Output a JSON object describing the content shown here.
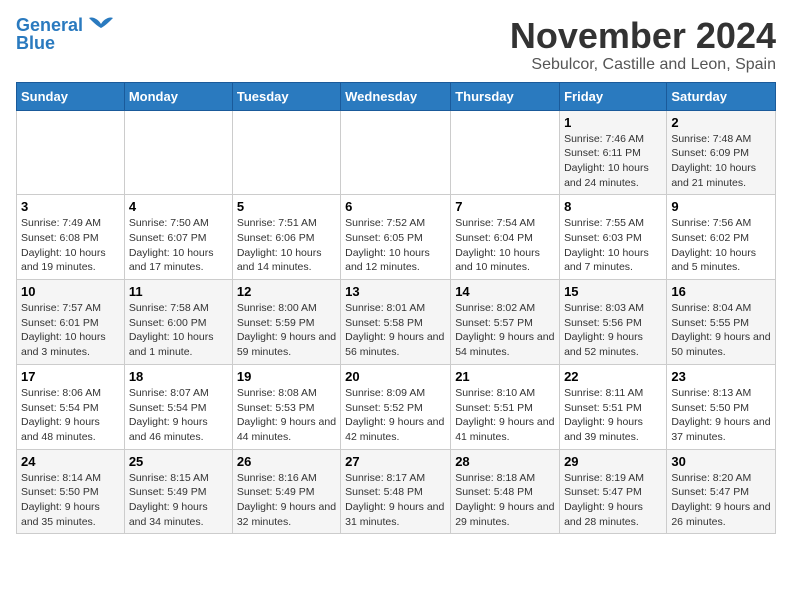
{
  "header": {
    "logo_line1": "General",
    "logo_line2": "Blue",
    "month": "November 2024",
    "location": "Sebulcor, Castille and Leon, Spain"
  },
  "weekdays": [
    "Sunday",
    "Monday",
    "Tuesday",
    "Wednesday",
    "Thursday",
    "Friday",
    "Saturday"
  ],
  "weeks": [
    [
      {
        "day": "",
        "info": ""
      },
      {
        "day": "",
        "info": ""
      },
      {
        "day": "",
        "info": ""
      },
      {
        "day": "",
        "info": ""
      },
      {
        "day": "",
        "info": ""
      },
      {
        "day": "1",
        "info": "Sunrise: 7:46 AM\nSunset: 6:11 PM\nDaylight: 10 hours and 24 minutes."
      },
      {
        "day": "2",
        "info": "Sunrise: 7:48 AM\nSunset: 6:09 PM\nDaylight: 10 hours and 21 minutes."
      }
    ],
    [
      {
        "day": "3",
        "info": "Sunrise: 7:49 AM\nSunset: 6:08 PM\nDaylight: 10 hours and 19 minutes."
      },
      {
        "day": "4",
        "info": "Sunrise: 7:50 AM\nSunset: 6:07 PM\nDaylight: 10 hours and 17 minutes."
      },
      {
        "day": "5",
        "info": "Sunrise: 7:51 AM\nSunset: 6:06 PM\nDaylight: 10 hours and 14 minutes."
      },
      {
        "day": "6",
        "info": "Sunrise: 7:52 AM\nSunset: 6:05 PM\nDaylight: 10 hours and 12 minutes."
      },
      {
        "day": "7",
        "info": "Sunrise: 7:54 AM\nSunset: 6:04 PM\nDaylight: 10 hours and 10 minutes."
      },
      {
        "day": "8",
        "info": "Sunrise: 7:55 AM\nSunset: 6:03 PM\nDaylight: 10 hours and 7 minutes."
      },
      {
        "day": "9",
        "info": "Sunrise: 7:56 AM\nSunset: 6:02 PM\nDaylight: 10 hours and 5 minutes."
      }
    ],
    [
      {
        "day": "10",
        "info": "Sunrise: 7:57 AM\nSunset: 6:01 PM\nDaylight: 10 hours and 3 minutes."
      },
      {
        "day": "11",
        "info": "Sunrise: 7:58 AM\nSunset: 6:00 PM\nDaylight: 10 hours and 1 minute."
      },
      {
        "day": "12",
        "info": "Sunrise: 8:00 AM\nSunset: 5:59 PM\nDaylight: 9 hours and 59 minutes."
      },
      {
        "day": "13",
        "info": "Sunrise: 8:01 AM\nSunset: 5:58 PM\nDaylight: 9 hours and 56 minutes."
      },
      {
        "day": "14",
        "info": "Sunrise: 8:02 AM\nSunset: 5:57 PM\nDaylight: 9 hours and 54 minutes."
      },
      {
        "day": "15",
        "info": "Sunrise: 8:03 AM\nSunset: 5:56 PM\nDaylight: 9 hours and 52 minutes."
      },
      {
        "day": "16",
        "info": "Sunrise: 8:04 AM\nSunset: 5:55 PM\nDaylight: 9 hours and 50 minutes."
      }
    ],
    [
      {
        "day": "17",
        "info": "Sunrise: 8:06 AM\nSunset: 5:54 PM\nDaylight: 9 hours and 48 minutes."
      },
      {
        "day": "18",
        "info": "Sunrise: 8:07 AM\nSunset: 5:54 PM\nDaylight: 9 hours and 46 minutes."
      },
      {
        "day": "19",
        "info": "Sunrise: 8:08 AM\nSunset: 5:53 PM\nDaylight: 9 hours and 44 minutes."
      },
      {
        "day": "20",
        "info": "Sunrise: 8:09 AM\nSunset: 5:52 PM\nDaylight: 9 hours and 42 minutes."
      },
      {
        "day": "21",
        "info": "Sunrise: 8:10 AM\nSunset: 5:51 PM\nDaylight: 9 hours and 41 minutes."
      },
      {
        "day": "22",
        "info": "Sunrise: 8:11 AM\nSunset: 5:51 PM\nDaylight: 9 hours and 39 minutes."
      },
      {
        "day": "23",
        "info": "Sunrise: 8:13 AM\nSunset: 5:50 PM\nDaylight: 9 hours and 37 minutes."
      }
    ],
    [
      {
        "day": "24",
        "info": "Sunrise: 8:14 AM\nSunset: 5:50 PM\nDaylight: 9 hours and 35 minutes."
      },
      {
        "day": "25",
        "info": "Sunrise: 8:15 AM\nSunset: 5:49 PM\nDaylight: 9 hours and 34 minutes."
      },
      {
        "day": "26",
        "info": "Sunrise: 8:16 AM\nSunset: 5:49 PM\nDaylight: 9 hours and 32 minutes."
      },
      {
        "day": "27",
        "info": "Sunrise: 8:17 AM\nSunset: 5:48 PM\nDaylight: 9 hours and 31 minutes."
      },
      {
        "day": "28",
        "info": "Sunrise: 8:18 AM\nSunset: 5:48 PM\nDaylight: 9 hours and 29 minutes."
      },
      {
        "day": "29",
        "info": "Sunrise: 8:19 AM\nSunset: 5:47 PM\nDaylight: 9 hours and 28 minutes."
      },
      {
        "day": "30",
        "info": "Sunrise: 8:20 AM\nSunset: 5:47 PM\nDaylight: 9 hours and 26 minutes."
      }
    ]
  ]
}
